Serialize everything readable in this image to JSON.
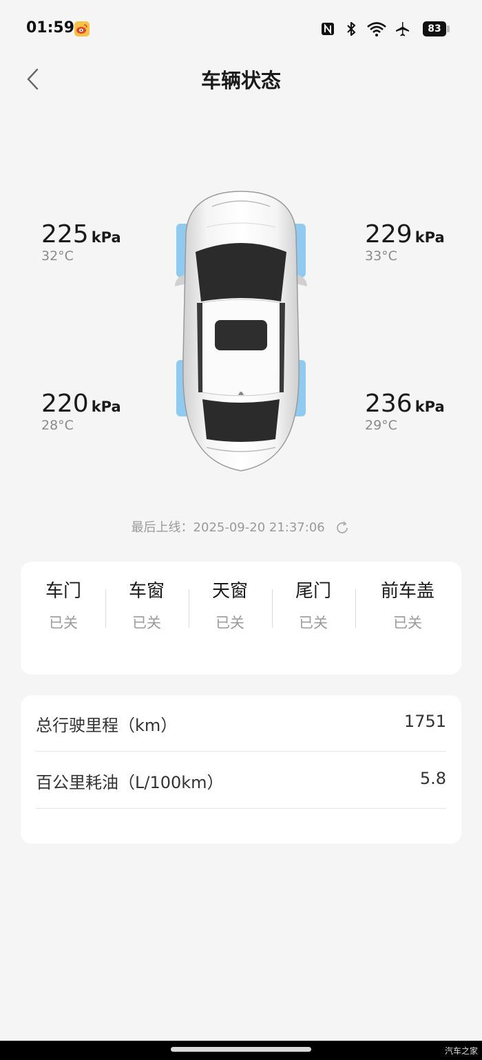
{
  "status_bar": {
    "time": "01:59",
    "battery": "83"
  },
  "header": {
    "title": "车辆状态"
  },
  "tires": {
    "front_left": {
      "kpa": "225",
      "temp": "32°C"
    },
    "front_right": {
      "kpa": "229",
      "temp": "33°C"
    },
    "rear_left": {
      "kpa": "220",
      "temp": "28°C"
    },
    "rear_right": {
      "kpa": "236",
      "temp": "29°C"
    },
    "unit": "kPa"
  },
  "last_online": {
    "label": "最后上线：2025-09-20 21:37:06"
  },
  "openings": [
    {
      "label": "车门",
      "value": "已关"
    },
    {
      "label": "车窗",
      "value": "已关"
    },
    {
      "label": "天窗",
      "value": "已关"
    },
    {
      "label": "尾门",
      "value": "已关"
    },
    {
      "label": "前车盖",
      "value": "已关"
    }
  ],
  "stats": [
    {
      "label": "总行驶里程（km）",
      "value": "1751"
    },
    {
      "label": "百公里耗油（L/100km）",
      "value": "5.8"
    }
  ],
  "watermark": "汽车之家",
  "colors": {
    "tire_highlight": "#7cc3f0",
    "background": "#f5f5f5"
  }
}
